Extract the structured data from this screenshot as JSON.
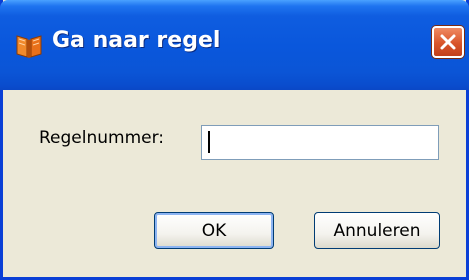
{
  "window": {
    "title": "Ga naar regel"
  },
  "form": {
    "label": "Regelnummer:",
    "input_value": ""
  },
  "buttons": {
    "ok_label": "OK",
    "cancel_label": "Annuleren"
  },
  "icons": {
    "title_icon": "book-icon",
    "close_icon": "close-icon"
  },
  "colors": {
    "titlebar": "#0a57dc",
    "close_button": "#d8552b",
    "dialog_bg": "#ece9d8",
    "icon": "#e8701a"
  }
}
